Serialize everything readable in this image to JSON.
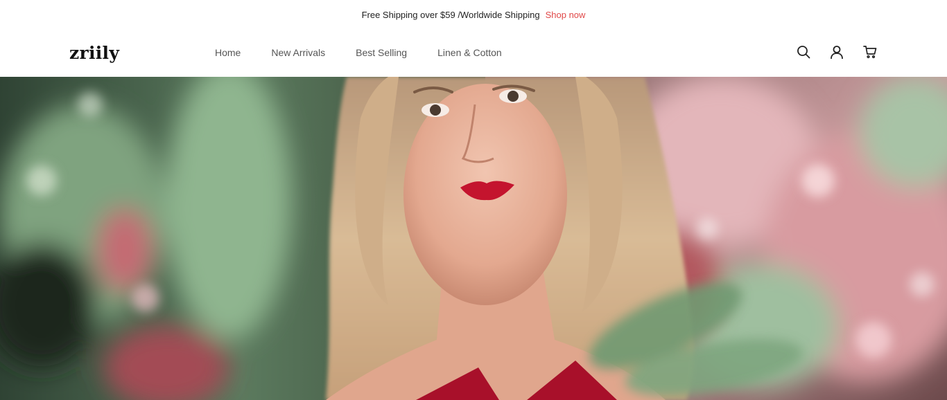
{
  "announcement": {
    "text": "Free Shipping over $59 /Worldwide Shipping",
    "link": "Shop now",
    "link_color": "#e04848"
  },
  "header": {
    "logo": "zriily",
    "nav": [
      {
        "label": "Home"
      },
      {
        "label": "New Arrivals"
      },
      {
        "label": "Best Selling"
      },
      {
        "label": "Linen & Cotton"
      }
    ],
    "icons": [
      "search-icon",
      "account-icon",
      "cart-icon"
    ]
  },
  "hero": {
    "image": "woman-with-wavy-blonde-hair-among-flowers"
  }
}
